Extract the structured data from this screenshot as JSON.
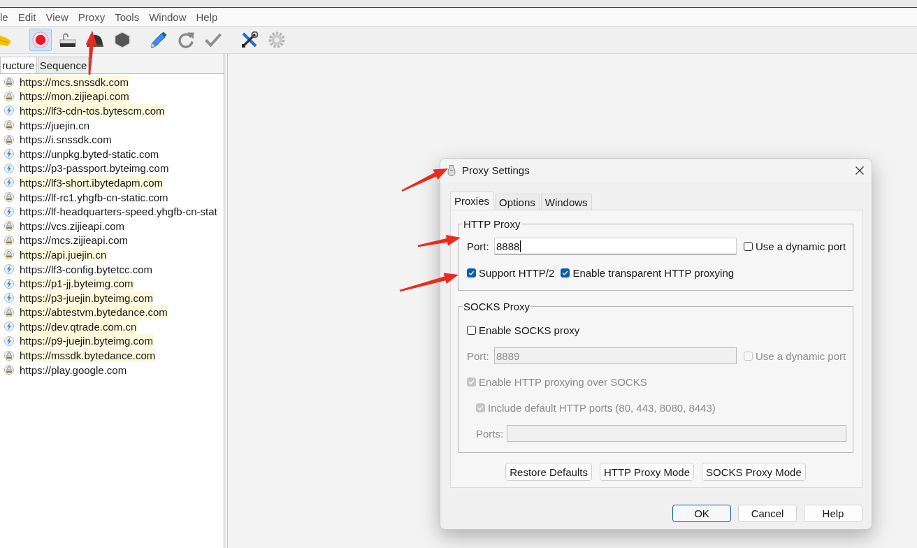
{
  "menu_bar": [
    "le",
    "Edit",
    "View",
    "Proxy",
    "Tools",
    "Window",
    "Help"
  ],
  "toolbar": [
    [
      {
        "kind": "broom",
        "pressed": false
      },
      {
        "kind": "record",
        "pressed": true
      },
      {
        "kind": "lock",
        "pressed": false
      },
      {
        "kind": "turtle",
        "pressed": false
      },
      {
        "kind": "hexagon",
        "pressed": false
      }
    ],
    [
      {
        "kind": "pen",
        "pressed": false
      },
      {
        "kind": "refresh",
        "pressed": false
      },
      {
        "kind": "check",
        "pressed": false
      }
    ],
    [
      {
        "kind": "tools",
        "pressed": false
      },
      {
        "kind": "gear",
        "pressed": false
      }
    ]
  ],
  "session_tabs": [
    {
      "label": "ructure",
      "selected": true
    },
    {
      "label": "Sequence",
      "selected": false
    }
  ],
  "hosts": [
    {
      "url": "https://mcs.snssdk.com",
      "kind": "lock",
      "highlighted": true
    },
    {
      "url": "https://mon.zijieapi.com",
      "kind": "lock",
      "highlighted": true
    },
    {
      "url": "https://lf3-cdn-tos.bytescm.com",
      "kind": "bolt",
      "highlighted": true
    },
    {
      "url": "https://juejin.cn",
      "kind": "lock",
      "highlighted": false
    },
    {
      "url": "https://i.snssdk.com",
      "kind": "lock",
      "highlighted": false
    },
    {
      "url": "https://unpkg.byted-static.com",
      "kind": "bolt",
      "highlighted": false
    },
    {
      "url": "https://p3-passport.byteimg.com",
      "kind": "bolt",
      "highlighted": false
    },
    {
      "url": "https://lf3-short.ibytedapm.com",
      "kind": "bolt",
      "highlighted": true
    },
    {
      "url": "https://lf-rc1.yhgfb-cn-static.com",
      "kind": "lock",
      "highlighted": false
    },
    {
      "url": "https://lf-headquarters-speed.yhgfb-cn-stat",
      "kind": "bolt",
      "highlighted": false
    },
    {
      "url": "https://vcs.zijieapi.com",
      "kind": "lock",
      "highlighted": false
    },
    {
      "url": "https://mcs.zijieapi.com",
      "kind": "lock",
      "highlighted": false
    },
    {
      "url": "https://api.juejin.cn",
      "kind": "lock",
      "highlighted": true
    },
    {
      "url": "https://lf3-config.bytetcc.com",
      "kind": "bolt",
      "highlighted": false
    },
    {
      "url": "https://p1-jj.byteimg.com",
      "kind": "bolt",
      "highlighted": true
    },
    {
      "url": "https://p3-juejin.byteimg.com",
      "kind": "bolt",
      "highlighted": true
    },
    {
      "url": "https://abtestvm.bytedance.com",
      "kind": "lock",
      "highlighted": true
    },
    {
      "url": "https://dev.qtrade.com.cn",
      "kind": "bolt",
      "highlighted": true
    },
    {
      "url": "https://p9-juejin.byteimg.com",
      "kind": "bolt",
      "highlighted": true
    },
    {
      "url": "https://mssdk.bytedance.com",
      "kind": "lock",
      "highlighted": true
    },
    {
      "url": "https://play.google.com",
      "kind": "lock",
      "highlighted": false
    }
  ],
  "dialog": {
    "title": "Proxy Settings",
    "tabs": [
      {
        "label": "Proxies",
        "selected": true
      },
      {
        "label": "Options",
        "selected": false
      },
      {
        "label": "Windows",
        "selected": false
      }
    ],
    "http_proxy": {
      "title": "HTTP Proxy",
      "port": {
        "label": "Port:",
        "value": "8888",
        "focused": true,
        "disabled": false
      },
      "dynamic_port": {
        "label": "Use a dynamic port",
        "checked": false,
        "disabled": false
      },
      "options": [
        {
          "label": "Support HTTP/2",
          "checked": true,
          "disabled": false
        },
        {
          "label": "Enable transparent HTTP proxying",
          "checked": true,
          "disabled": false
        }
      ]
    },
    "socks_proxy": {
      "title": "SOCKS Proxy",
      "enable": {
        "label": "Enable SOCKS proxy",
        "checked": false,
        "disabled": false
      },
      "port": {
        "label": "Port:",
        "value": "8889",
        "focused": false,
        "disabled": true
      },
      "dynamic_port": {
        "label": "Use a dynamic port",
        "checked": false,
        "disabled": true
      },
      "http_over_socks": {
        "label": "Enable HTTP proxying over SOCKS",
        "checked": true,
        "disabled": true
      },
      "include_default_ports": {
        "label": "Include default HTTP ports (80, 443, 8080, 8443)",
        "checked": true,
        "disabled": true
      },
      "ports": {
        "label": "Ports:",
        "focused": false,
        "disabled": true
      }
    },
    "panel_buttons": [
      "Restore Defaults",
      "HTTP Proxy Mode",
      "SOCKS Proxy Mode"
    ],
    "buttons": [
      {
        "label": "OK",
        "default": true
      },
      {
        "label": "Cancel",
        "default": false
      },
      {
        "label": "Help",
        "default": false
      }
    ]
  }
}
